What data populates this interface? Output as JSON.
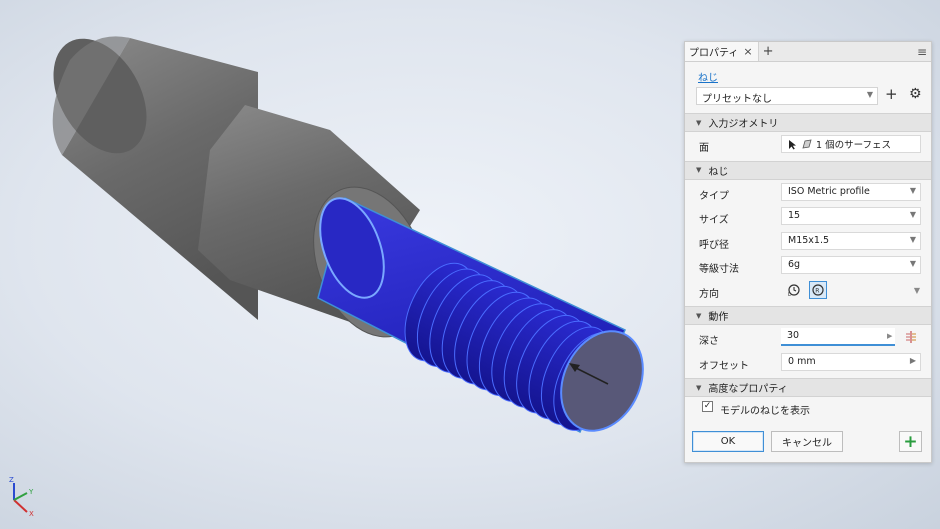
{
  "panel": {
    "tab_label": "プロパティ",
    "close_glyph": "×",
    "add_tab_glyph": "+",
    "menu_glyph": "≡",
    "thread_link": "ねじ",
    "preset_value": "プリセットなし",
    "preset_add": "+",
    "preset_gear": "⚙",
    "sections": {
      "input_geometry": "入力ジオメトリ",
      "thread": "ねじ",
      "behavior": "動作",
      "advanced": "高度なプロパティ"
    },
    "input_geometry": {
      "face_label": "面",
      "face_value": "1 個のサーフェス"
    },
    "thread": {
      "type_label": "タイプ",
      "type_value": "ISO Metric profile",
      "size_label": "サイズ",
      "size_value": "15",
      "designation_label": "呼び径",
      "designation_value": "M15x1.5",
      "class_label": "等級寸法",
      "class_value": "6g",
      "direction_label": "方向"
    },
    "behavior": {
      "depth_label": "深さ",
      "depth_value": "30",
      "offset_label": "オフセット",
      "offset_value": "0 mm"
    },
    "advanced": {
      "show_thread_label": "モデルのねじを表示",
      "show_thread_checked": true
    },
    "buttons": {
      "ok": "OK",
      "cancel": "キャンセル",
      "add": "+"
    }
  },
  "colors": {
    "accent": "#3f8fd6",
    "thread_face": "#2323c8",
    "body_gray": "#6b6b6b",
    "add_green": "#2a9d3f"
  },
  "icons": [
    "select-arrow-icon",
    "face-icon",
    "left-hand-icon",
    "right-hand-icon",
    "flip-direction-icon",
    "gear-icon",
    "view-cube-axis-icon"
  ]
}
